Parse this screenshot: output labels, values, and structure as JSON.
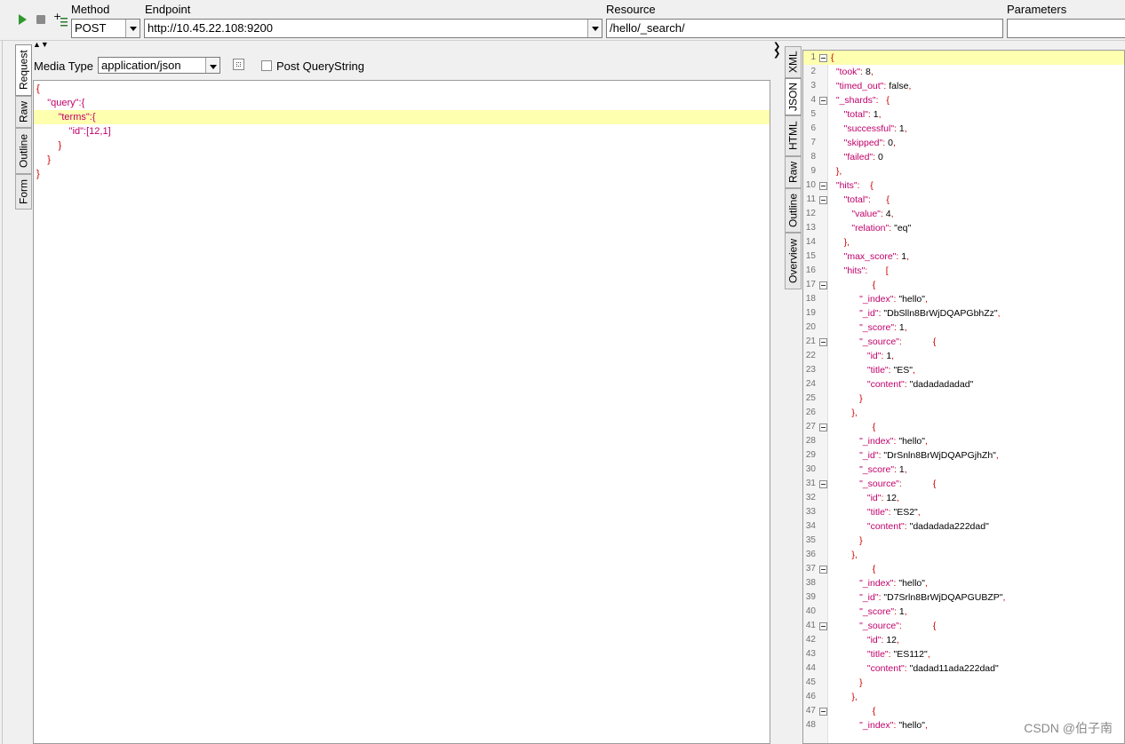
{
  "toolbar": {
    "method_label": "Method",
    "method_value": "POST",
    "endpoint_label": "Endpoint",
    "endpoint_value": "http://10.45.22.108:9200",
    "resource_label": "Resource",
    "resource_value": "/hello/_search/",
    "parameters_label": "Parameters"
  },
  "left_tabs": [
    "Request",
    "Raw",
    "Outline",
    "Form"
  ],
  "request_header": {
    "media_type_label": "Media Type",
    "media_type_value": "application/json",
    "post_querystring_label": "Post QueryString"
  },
  "request_body": [
    {
      "text": "{"
    },
    {
      "text": "    \"query\":{"
    },
    {
      "text": "        \"terms\":{"
    },
    {
      "text": "            \"id\":[12,1]"
    },
    {
      "text": "        }"
    },
    {
      "text": "    }"
    },
    {
      "text": "}"
    }
  ],
  "right_tabs": [
    "XML",
    "JSON",
    "HTML",
    "Raw",
    "Outline",
    "Overview"
  ],
  "response_lines": [
    {
      "n": "1",
      "fold": true,
      "text": "{"
    },
    {
      "n": "2",
      "fold": false,
      "text": "  \"took\": 8,"
    },
    {
      "n": "3",
      "fold": false,
      "text": "  \"timed_out\": false,"
    },
    {
      "n": "4",
      "fold": true,
      "text": "  \"_shards\":   {"
    },
    {
      "n": "5",
      "fold": false,
      "text": "     \"total\": 1,"
    },
    {
      "n": "6",
      "fold": false,
      "text": "     \"successful\": 1,"
    },
    {
      "n": "7",
      "fold": false,
      "text": "     \"skipped\": 0,"
    },
    {
      "n": "8",
      "fold": false,
      "text": "     \"failed\": 0"
    },
    {
      "n": "9",
      "fold": false,
      "text": "  },"
    },
    {
      "n": "10",
      "fold": true,
      "text": "  \"hits\":    {"
    },
    {
      "n": "11",
      "fold": true,
      "text": "     \"total\":      {"
    },
    {
      "n": "12",
      "fold": false,
      "text": "        \"value\": 4,"
    },
    {
      "n": "13",
      "fold": false,
      "text": "        \"relation\": \"eq\""
    },
    {
      "n": "14",
      "fold": false,
      "text": "     },"
    },
    {
      "n": "15",
      "fold": false,
      "text": "     \"max_score\": 1,"
    },
    {
      "n": "16",
      "fold": false,
      "text": "     \"hits\":       ["
    },
    {
      "n": "17",
      "fold": true,
      "text": "                {"
    },
    {
      "n": "18",
      "fold": false,
      "text": "           \"_index\": \"hello\","
    },
    {
      "n": "19",
      "fold": false,
      "text": "           \"_id\": \"DbSlln8BrWjDQAPGbhZz\","
    },
    {
      "n": "20",
      "fold": false,
      "text": "           \"_score\": 1,"
    },
    {
      "n": "21",
      "fold": true,
      "text": "           \"_source\":            {"
    },
    {
      "n": "22",
      "fold": false,
      "text": "              \"id\": 1,"
    },
    {
      "n": "23",
      "fold": false,
      "text": "              \"title\": \"ES\","
    },
    {
      "n": "24",
      "fold": false,
      "text": "              \"content\": \"dadadadadad\""
    },
    {
      "n": "25",
      "fold": false,
      "text": "           }"
    },
    {
      "n": "26",
      "fold": false,
      "text": "        },"
    },
    {
      "n": "27",
      "fold": true,
      "text": "                {"
    },
    {
      "n": "28",
      "fold": false,
      "text": "           \"_index\": \"hello\","
    },
    {
      "n": "29",
      "fold": false,
      "text": "           \"_id\": \"DrSnln8BrWjDQAPGjhZh\","
    },
    {
      "n": "30",
      "fold": false,
      "text": "           \"_score\": 1,"
    },
    {
      "n": "31",
      "fold": true,
      "text": "           \"_source\":            {"
    },
    {
      "n": "32",
      "fold": false,
      "text": "              \"id\": 12,"
    },
    {
      "n": "33",
      "fold": false,
      "text": "              \"title\": \"ES2\","
    },
    {
      "n": "34",
      "fold": false,
      "text": "              \"content\": \"dadadada222dad\""
    },
    {
      "n": "35",
      "fold": false,
      "text": "           }"
    },
    {
      "n": "36",
      "fold": false,
      "text": "        },"
    },
    {
      "n": "37",
      "fold": true,
      "text": "                {"
    },
    {
      "n": "38",
      "fold": false,
      "text": "           \"_index\": \"hello\","
    },
    {
      "n": "39",
      "fold": false,
      "text": "           \"_id\": \"D7Srln8BrWjDQAPGUBZP\","
    },
    {
      "n": "40",
      "fold": false,
      "text": "           \"_score\": 1,"
    },
    {
      "n": "41",
      "fold": true,
      "text": "           \"_source\":            {"
    },
    {
      "n": "42",
      "fold": false,
      "text": "              \"id\": 12,"
    },
    {
      "n": "43",
      "fold": false,
      "text": "              \"title\": \"ES112\","
    },
    {
      "n": "44",
      "fold": false,
      "text": "              \"content\": \"dadad11ada222dad\""
    },
    {
      "n": "45",
      "fold": false,
      "text": "           }"
    },
    {
      "n": "46",
      "fold": false,
      "text": "        },"
    },
    {
      "n": "47",
      "fold": true,
      "text": "                {"
    },
    {
      "n": "48",
      "fold": false,
      "text": "           \"_index\": \"hello\","
    }
  ],
  "watermark": "CSDN @伯子南"
}
